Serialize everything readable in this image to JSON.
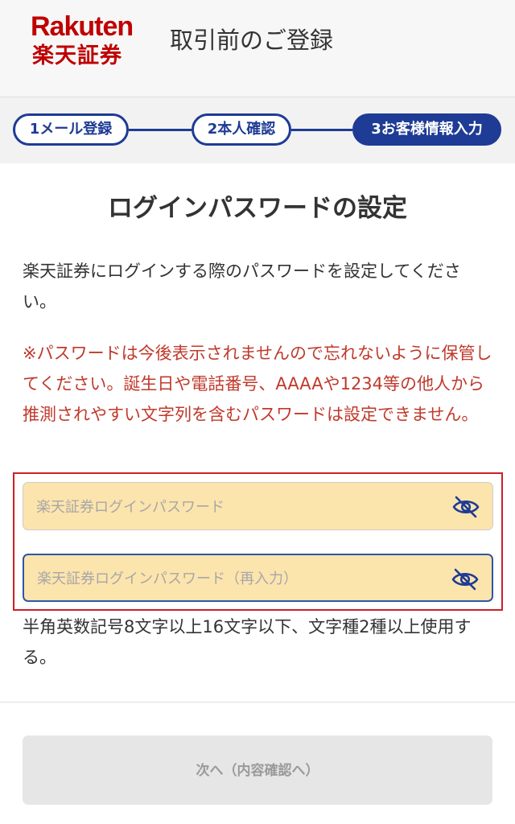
{
  "brand": {
    "logo_en": "Rakuten",
    "logo_ja": "楽天証券",
    "color": "#bf0000"
  },
  "header": {
    "title": "取引前のご登録"
  },
  "stepper": {
    "steps": [
      {
        "label": "1メール登録",
        "active": false
      },
      {
        "label": "2本人確認",
        "active": false
      },
      {
        "label": "3お客様情報入力",
        "active": true
      }
    ],
    "accent": "#1e3b95"
  },
  "page": {
    "title": "ログインパスワードの設定",
    "instruction": "楽天証券にログインする際のパスワードを設定してください。",
    "warning": "※パスワードは今後表示されませんので忘れないように保管してください。誕生日や電話番号、AAAAや1234等の他人から推測されやすい文字列を含むパスワードは設定できません。",
    "warning_color": "#c0392b"
  },
  "form": {
    "password": {
      "placeholder": "楽天証券ログインパスワード",
      "value": "",
      "icon": "eye-slash-icon"
    },
    "password_confirm": {
      "placeholder": "楽天証券ログインパスワード（再入力）",
      "value": "",
      "icon": "eye-slash-icon"
    },
    "hint": "半角英数記号8文字以上16文字以下、文字種2種以上使用する。"
  },
  "footer": {
    "next_label": "次へ（内容確認へ）",
    "next_enabled": false
  }
}
